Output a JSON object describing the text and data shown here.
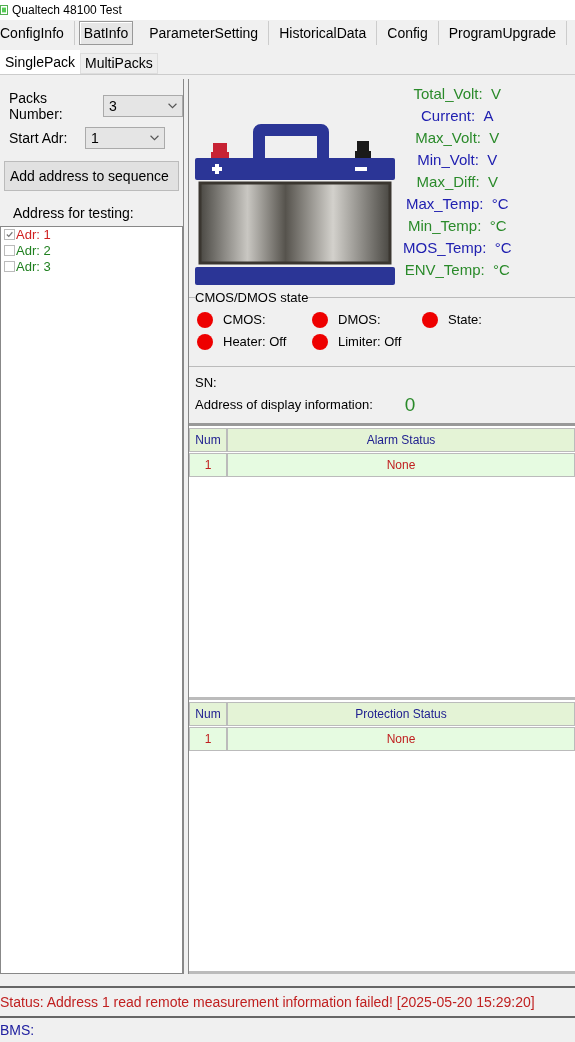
{
  "window": {
    "title": "Qualtech 48100 Test"
  },
  "tabs": [
    {
      "label": "ConfigInfo",
      "selected": false
    },
    {
      "label": "BatInfo",
      "selected": true
    },
    {
      "label": "ParameterSetting",
      "selected": false
    },
    {
      "label": "HistoricalData",
      "selected": false
    },
    {
      "label": "Config",
      "selected": false
    },
    {
      "label": "ProgramUpgrade",
      "selected": false
    }
  ],
  "subtabs": [
    {
      "label": "SinglePack",
      "selected": true
    },
    {
      "label": "MultiPacks",
      "selected": false
    }
  ],
  "sidebar": {
    "packs_label": "Packs Number:",
    "packs_value": "3",
    "start_label": "Start Adr:",
    "start_value": "1",
    "add_button": "Add address to sequence",
    "list_label": "Address for testing:",
    "addresses": [
      {
        "label": "Adr: 1",
        "checked": true,
        "color": "#d02020"
      },
      {
        "label": "Adr: 2",
        "checked": false,
        "color": "#208020"
      },
      {
        "label": "Adr: 3",
        "checked": false,
        "color": "#208020"
      }
    ]
  },
  "readings": [
    {
      "label": "Total_Volt:",
      "unit": "V",
      "color": "#2a8a2a"
    },
    {
      "label": "Current:",
      "unit": "A",
      "color": "#2020b0"
    },
    {
      "label": "Max_Volt:",
      "unit": "V",
      "color": "#2a8a2a"
    },
    {
      "label": "Min_Volt:",
      "unit": "V",
      "color": "#2020b0"
    },
    {
      "label": "Max_Diff:",
      "unit": "V",
      "color": "#2a8a2a"
    },
    {
      "label": "Max_Temp:",
      "unit": "°C",
      "color": "#2020b0"
    },
    {
      "label": "Min_Temp:",
      "unit": "°C",
      "color": "#2a8a2a"
    },
    {
      "label": "MOS_Temp:",
      "unit": "°C",
      "color": "#2020b0"
    },
    {
      "label": "ENV_Temp:",
      "unit": "°C",
      "color": "#2a8a2a"
    }
  ],
  "mos_group": {
    "title": "CMOS/DMOS state",
    "leds": [
      {
        "label": "CMOS:",
        "color": "#ee0000"
      },
      {
        "label": "DMOS:",
        "color": "#ee0000"
      },
      {
        "label": "State:",
        "color": "#ee0000"
      },
      {
        "label": "Heater: Off",
        "color": "#ee0000"
      },
      {
        "label": "Limiter: Off",
        "color": "#ee0000"
      }
    ]
  },
  "info": {
    "sn_label": "SN:",
    "address_label": "Address of display information:",
    "address_value": "0"
  },
  "tables": [
    {
      "columns": [
        "Num",
        "Alarm Status"
      ],
      "rows": [
        [
          "1",
          "None"
        ]
      ]
    },
    {
      "columns": [
        "Num",
        "Protection Status"
      ],
      "rows": [
        [
          "1",
          "None"
        ]
      ]
    }
  ],
  "status_bar": {
    "status": "Status: Address 1 read remote measurement information failed! [2025-05-20 15:29:20]",
    "bms": "BMS:"
  }
}
